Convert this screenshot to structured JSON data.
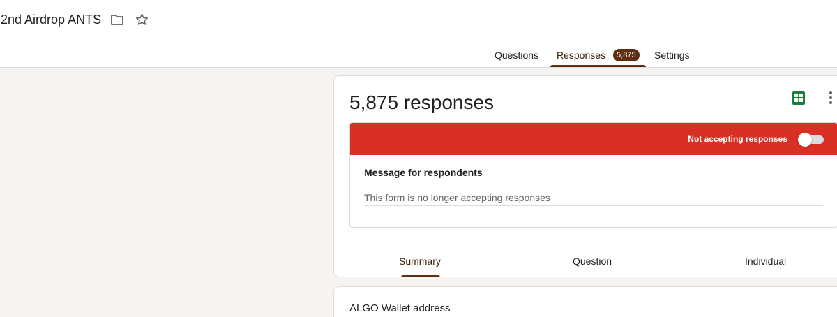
{
  "form": {
    "title": "2nd Airdrop ANTS"
  },
  "icons": {
    "folder": "folder-icon",
    "star": "star-icon",
    "sheets": "google-sheets-icon",
    "more": "more-vertical-icon"
  },
  "tabs": [
    {
      "label": "Questions"
    },
    {
      "label": "Responses",
      "badge": "5,875"
    },
    {
      "label": "Settings"
    }
  ],
  "responses": {
    "count_label": "5,875 responses",
    "status_label": "Not accepting responses",
    "accepting": false,
    "message_label": "Message for respondents",
    "message_value": "This form is no longer accepting responses"
  },
  "sub_tabs": [
    {
      "label": "Summary"
    },
    {
      "label": "Question"
    },
    {
      "label": "Individual"
    }
  ],
  "question": {
    "title": "ALGO Wallet address"
  },
  "colors": {
    "accent": "#5d2e0f",
    "banner": "#d93025",
    "background": "#f7f3f0"
  }
}
